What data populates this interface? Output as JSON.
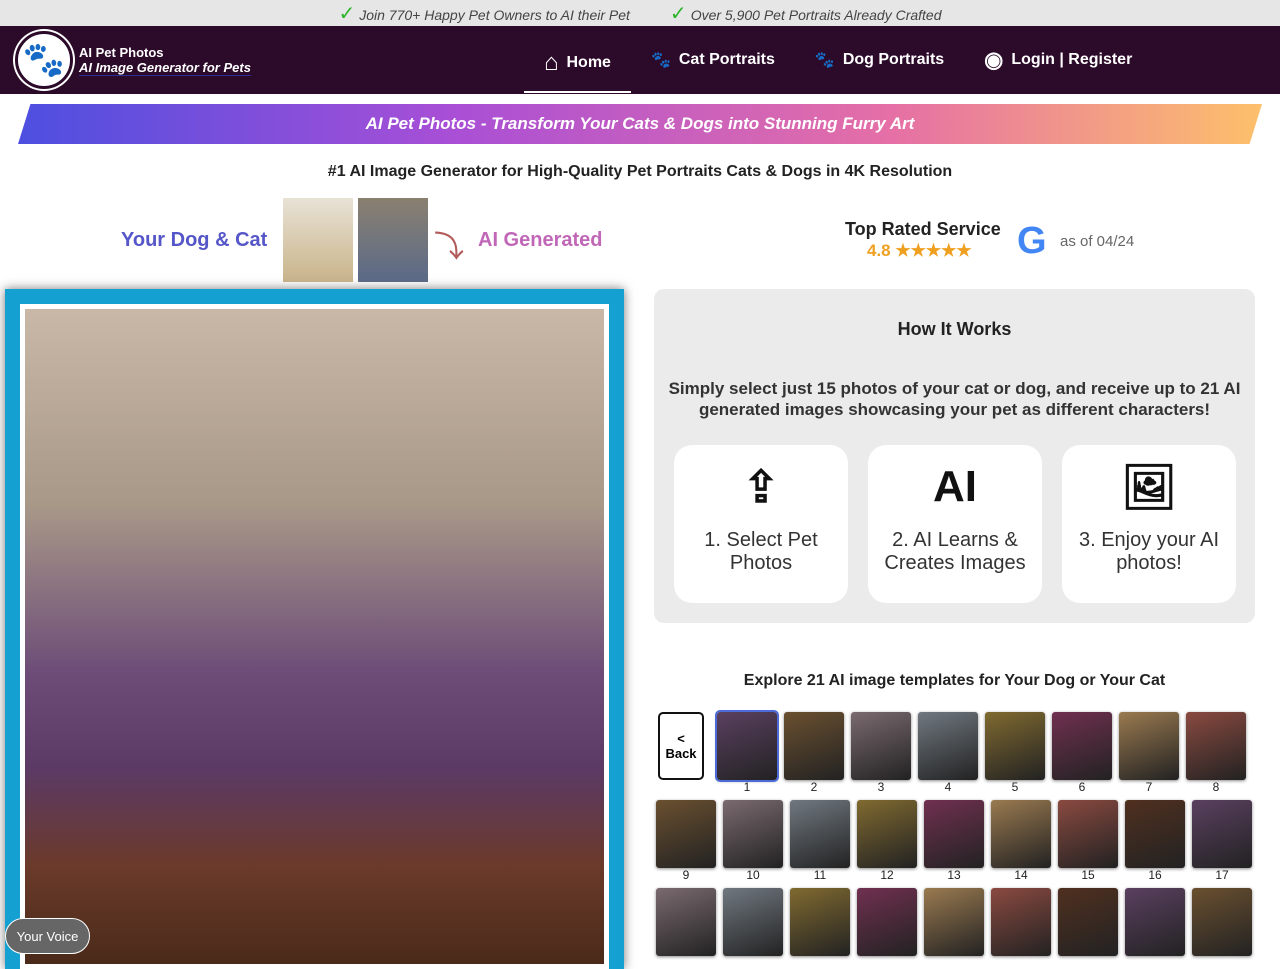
{
  "topbar": {
    "items": [
      "Join 770+ Happy Pet Owners to AI their Pet",
      "Over 5,900 Pet Portraits Already Crafted"
    ]
  },
  "brand": {
    "name": "AI Pet Photos",
    "tagline": "AI Image Generator for Pets"
  },
  "nav": {
    "home": "Home",
    "cat": "Cat Portraits",
    "dog": "Dog Portraits",
    "login": "Login | Register"
  },
  "banner": "AI Pet Photos - Transform Your Cats & Dogs into Stunning Furry Art",
  "subtitle": "#1 AI Image Generator for High-Quality Pet Portraits Cats & Dogs in 4K Resolution",
  "compare": {
    "left": "Your Dog & Cat",
    "right": "AI Generated"
  },
  "rating": {
    "title": "Top Rated Service",
    "score": "4.8",
    "stars": "★★★★★",
    "as_of": "as of 04/24"
  },
  "how": {
    "title": "How It Works",
    "desc": "Simply select just 15 photos of your cat or dog, and receive up to 21 AI generated images showcasing your pet as different characters!",
    "steps": [
      "1. Select Pet Photos",
      "2. AI Learns & Creates Images",
      "3. Enjoy your AI photos!"
    ],
    "ai_glyph": "AI"
  },
  "explore": {
    "title": "Explore 21 AI image templates for Your Dog or Your Cat",
    "back_lt": "<",
    "back": "Back",
    "row1": [
      "1",
      "2",
      "3",
      "4",
      "5",
      "6",
      "7",
      "8"
    ],
    "row2": [
      "9",
      "10",
      "11",
      "12",
      "13",
      "14",
      "15",
      "16",
      "17"
    ],
    "row3": [
      "",
      "",
      "",
      "",
      "",
      "",
      "",
      "",
      ""
    ]
  },
  "voice": "Your Voice",
  "colors": {
    "nav": "#2c0a2a",
    "hero_frame": "#15a0d2",
    "accent_star": "#f0a020"
  }
}
